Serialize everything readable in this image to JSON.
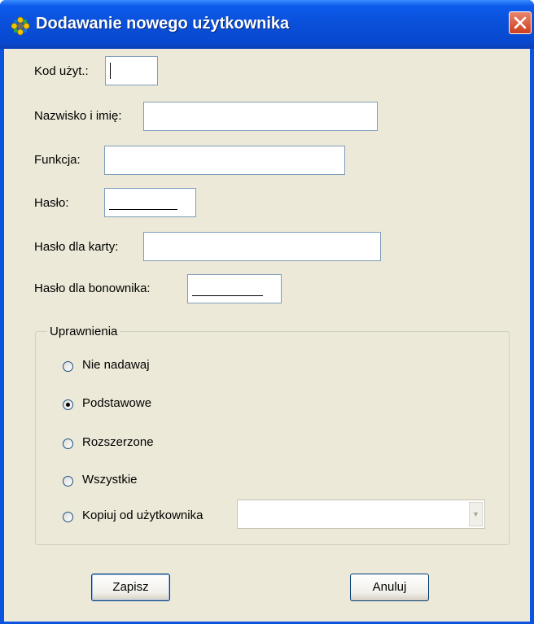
{
  "window": {
    "title": "Dodawanie nowego użytkownika",
    "close_glyph": "✕",
    "icon": "app-settings-icon"
  },
  "form": {
    "user_code_label": "Kod użyt.:",
    "user_code_value": "",
    "name_label": "Nazwisko i imię:",
    "name_value": "",
    "function_label": "Funkcja:",
    "function_value": "",
    "password_label": "Hasło:",
    "card_password_label": "Hasło dla karty:",
    "card_password_value": "",
    "voucher_password_label": "Hasło dla bonownika:"
  },
  "permissions": {
    "group_label": "Uprawnienia",
    "options": [
      {
        "label": "Nie nadawaj",
        "selected": false
      },
      {
        "label": "Podstawowe",
        "selected": true
      },
      {
        "label": "Rozszerzone",
        "selected": false
      },
      {
        "label": "Wszystkie",
        "selected": false
      },
      {
        "label": "Kopiuj od użytkownika",
        "selected": false
      }
    ],
    "copy_from_value": "",
    "dropdown_glyph": "▼"
  },
  "buttons": {
    "save_label": "Zapisz",
    "cancel_label": "Anuluj"
  },
  "colors": {
    "titlebar": "#0a54e0",
    "dialog_bg": "#ece9d8",
    "close_button": "#d9572f"
  }
}
